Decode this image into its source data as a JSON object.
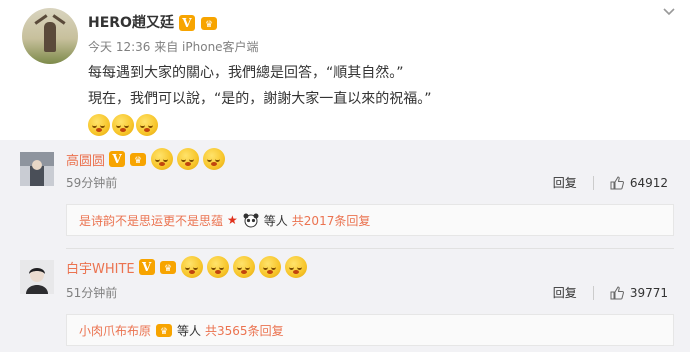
{
  "post": {
    "username": "HERO趙又廷",
    "time": "今天 12:36",
    "source": "来自 iPhone客户端",
    "lines": [
      "每每遇到大家的關心，我們總是回答，“順其自然。”",
      "現在，我們可以說，“是的，謝謝大家一直以來的祝福。”"
    ],
    "emoji_count": 3
  },
  "comments": [
    {
      "name": "高圆圆",
      "time": "59分钟前",
      "reply_label": "回复",
      "likes": "64912",
      "emoji_count": 3,
      "sub": {
        "text": "是诗韵不是思运更不是思蕴",
        "plain": "等人",
        "total": "共2017条回复"
      }
    },
    {
      "name": "白宇WHITE",
      "time": "51分钟前",
      "reply_label": "回复",
      "likes": "39771",
      "emoji_count": 5,
      "sub": {
        "text": "小肉爪布布原",
        "plain": "等人",
        "total": "共3565条回复"
      }
    }
  ],
  "colors": {
    "accent": "#eb7350",
    "vip": "#f7a400",
    "comments_bg": "#f2f2f5"
  }
}
